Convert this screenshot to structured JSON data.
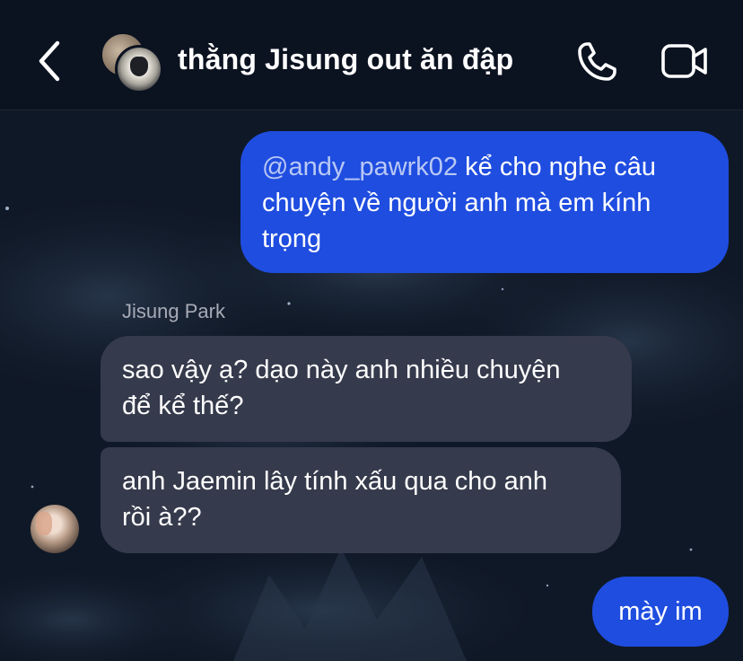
{
  "header": {
    "title": "thằng Jisung out ăn đập",
    "back_icon": "chevron-left-icon",
    "call_icon": "phone-icon",
    "video_icon": "video-camera-icon"
  },
  "messages": [
    {
      "direction": "outgoing",
      "mention": "@andy_pawrk02",
      "lines": [
        "kể cho nghe câu",
        "chuyện về người anh mà em kính",
        "trọng"
      ]
    },
    {
      "direction": "incoming",
      "sender": "Jisung Park",
      "lines": [
        "sao vậy ạ? dạo này anh nhiều chuyện",
        "để kể thế?"
      ]
    },
    {
      "direction": "incoming",
      "lines": [
        "anh Jaemin lây tính xấu qua cho anh",
        "rồi à??"
      ]
    },
    {
      "direction": "outgoing",
      "lines": [
        "mày im"
      ]
    }
  ],
  "colors": {
    "outgoing_bubble": "#1f4de0",
    "incoming_bubble": "#353a4c",
    "background": "#0f1826",
    "header": "#0b1220"
  }
}
